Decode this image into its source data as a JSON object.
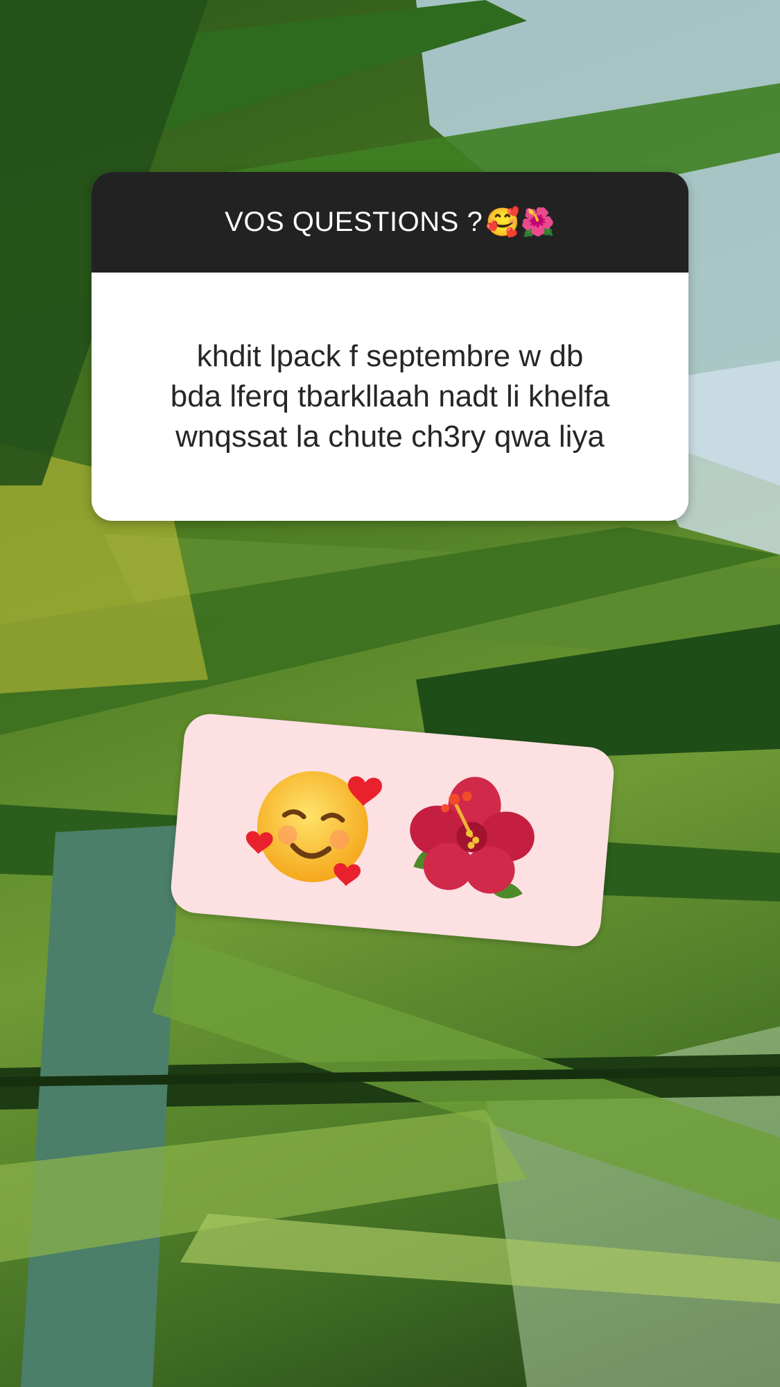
{
  "question_sticker": {
    "header": "VOS QUESTIONS ?",
    "header_emojis": "🥰🌺",
    "answer": "khdit lpack f septembre w db\nbda lferq tbarkllaah nadt li khelfa\nwnqssat la chute ch3ry qwa liya"
  },
  "emoji_sticker": {
    "emojis": [
      "smiling-face-with-hearts",
      "hibiscus"
    ],
    "background": "#fce0e2"
  },
  "colors": {
    "header_bg": "#222222",
    "card_bg": "#ffffff",
    "text": "#262626"
  }
}
